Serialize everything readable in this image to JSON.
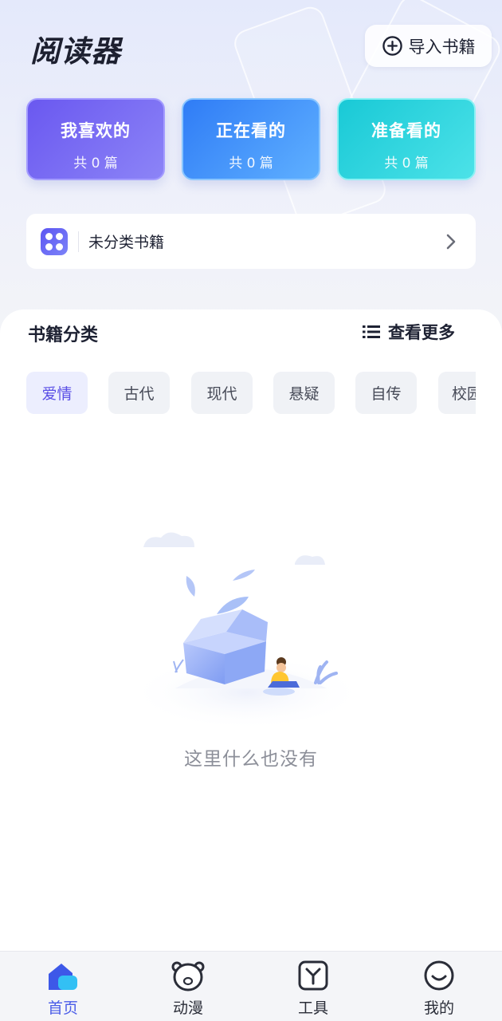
{
  "header": {
    "title": "阅读器",
    "import_label": "导入书籍"
  },
  "shelves": [
    {
      "label": "我喜欢的",
      "count": "共 0 篇",
      "color": "#6a58f0"
    },
    {
      "label": "正在看的",
      "count": "共 0 篇",
      "color": "#2f7cf6"
    },
    {
      "label": "准备看的",
      "count": "共 0 篇",
      "color": "#19c9d6"
    }
  ],
  "uncategorized": {
    "label": "未分类书籍",
    "icon": "grid-apps-icon"
  },
  "categories": {
    "title": "书籍分类",
    "more_label": "查看更多",
    "chips": [
      "爱情",
      "古代",
      "现代",
      "悬疑",
      "自传",
      "校园"
    ],
    "selected": "爱情"
  },
  "empty_state": {
    "message": "这里什么也没有",
    "icon": "empty-box-illustration"
  },
  "tabbar": {
    "items": [
      {
        "label": "首页",
        "icon": "home-icon",
        "active": true
      },
      {
        "label": "动漫",
        "icon": "bear-icon",
        "active": false
      },
      {
        "label": "工具",
        "icon": "tools-icon",
        "active": false
      },
      {
        "label": "我的",
        "icon": "smile-icon",
        "active": false
      }
    ]
  },
  "colors": {
    "accent": "#5a4fe6",
    "tab_active": "#4a5ce8"
  }
}
